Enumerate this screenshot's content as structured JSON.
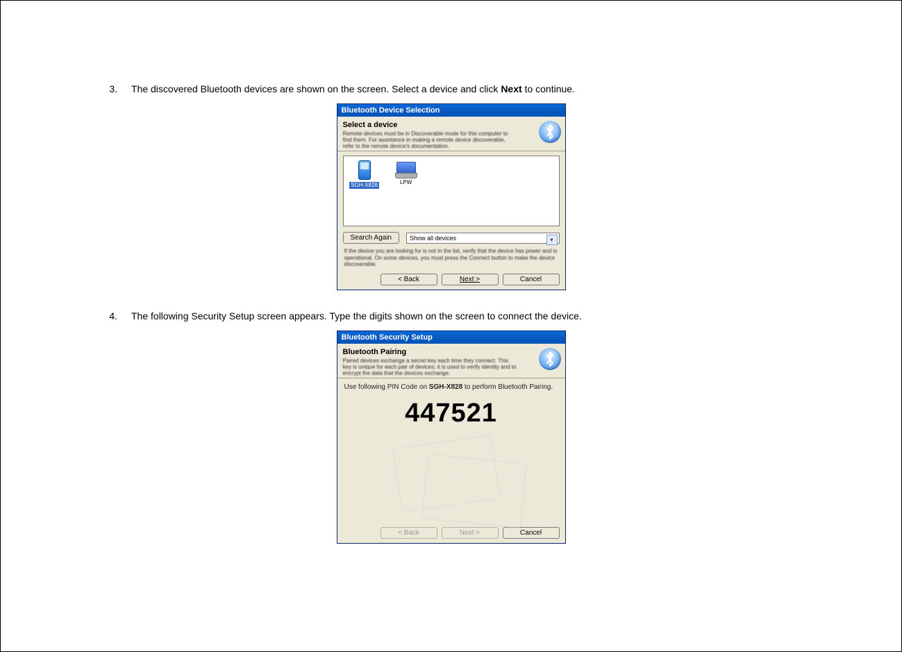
{
  "steps": {
    "s3_num": "3.",
    "s3_text_a": "The discovered Bluetooth devices are shown on the screen. Select a device and click ",
    "s3_text_bold": "Next",
    "s3_text_b": " to continue.",
    "s4_num": "4.",
    "s4_text": "The following Security Setup screen appears. Type the digits shown on the screen to connect the device."
  },
  "dialog1": {
    "title": "Bluetooth Device Selection",
    "hdr_title": "Select a device",
    "hdr_desc": "Remote devices must be in Discoverable mode for this computer to find them. For assistance in making a remote device discoverable, refer to the remote device's documentation.",
    "device1_label": "SGH-X828",
    "device2_label": "LPW",
    "search_again": "Search Again",
    "filter_label": "Show all devices",
    "hint": "If the device you are looking for is not in the list, verify that the device has power and is operational. On some devices, you must press the Connect button to make the device discoverable.",
    "back": "< Back",
    "next": "Next >",
    "cancel": "Cancel"
  },
  "dialog2": {
    "title": "Bluetooth Security Setup",
    "hdr_title": "Bluetooth Pairing",
    "hdr_desc": "Paired devices exchange a secret key each time they connect. This key is unique for each pair of devices; it is used to verify identity and to encrypt the data that the devices exchange.",
    "pair_text_a": "Use following PIN Code on ",
    "pair_text_bold": "SGH-X828",
    "pair_text_b": " to perform Bluetooth Pairing.",
    "pin": "447521",
    "back": "< Back",
    "next": "Next >",
    "cancel": "Cancel"
  }
}
